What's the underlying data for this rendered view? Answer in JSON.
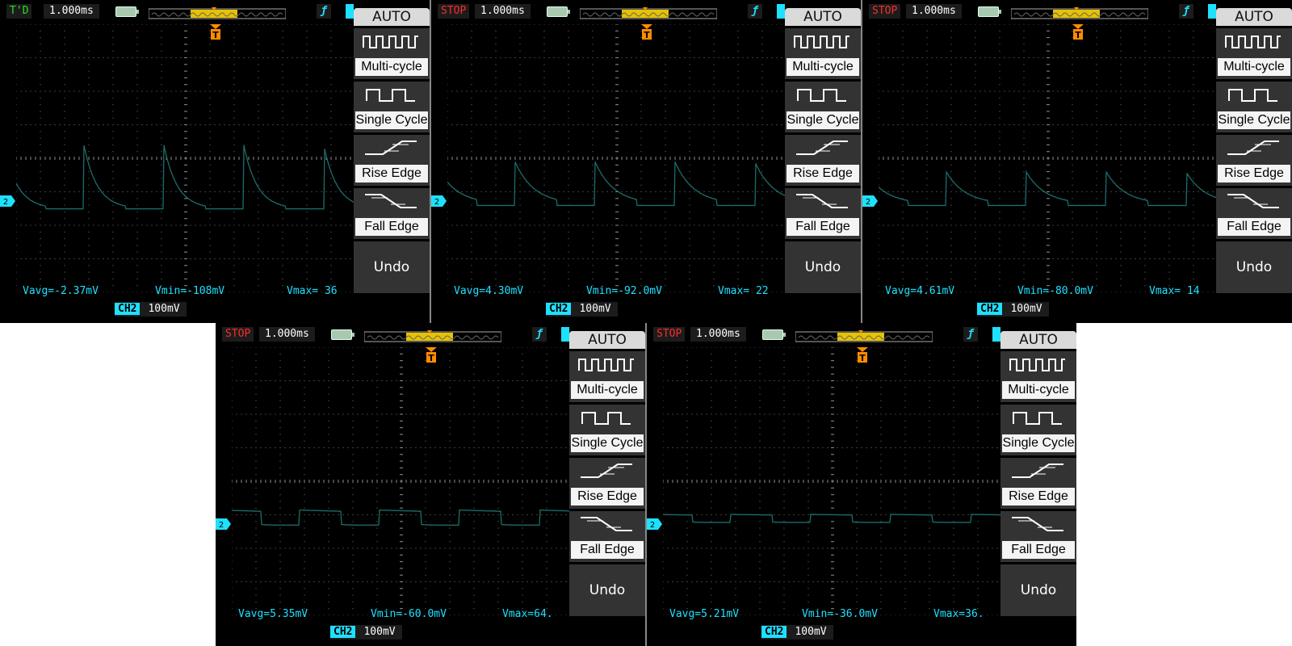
{
  "menu": {
    "title": "AUTO",
    "items": [
      "Multi-cycle",
      "Single Cycle",
      "Rise Edge",
      "Fall Edge"
    ],
    "undo": "Undo"
  },
  "colors": {
    "trace": "#1a6e6e",
    "cyan": "#1ee0ff",
    "stop": "#ff2a2a",
    "run": "#22e022",
    "trig": "#ff8c00"
  },
  "trigger_icon": "f-trigger-icon",
  "ground_marker": "2",
  "screens": [
    {
      "status": "T'D",
      "state": "run",
      "timebase": "1.000ms",
      "channel": "CH2",
      "volts_div": "100mV",
      "vavg": "Vavg=-2.37mV",
      "vmin": "Vmin=-108mV",
      "vmax": "Vmax= 36",
      "signal": {
        "kind": "spike",
        "high": 150,
        "low": -40,
        "base": 0,
        "period": 3.3,
        "phase": 2.8
      }
    },
    {
      "status": "STOP",
      "state": "stop",
      "timebase": "1.000ms",
      "channel": "CH2",
      "volts_div": "100mV",
      "vavg": "Vavg=4.30mV",
      "vmin": "Vmin=-92.0mV",
      "vmax": "Vmax= 22",
      "signal": {
        "kind": "decay",
        "high": 90,
        "low": -30,
        "base": 0,
        "period": 3.3,
        "phase": 2.8
      }
    },
    {
      "status": "STOP",
      "state": "stop",
      "timebase": "1.000ms",
      "channel": "CH2",
      "volts_div": "100mV",
      "vavg": "Vavg=4.61mV",
      "vmin": "Vmin=-80.0mV",
      "vmax": "Vmax= 14",
      "signal": {
        "kind": "decay",
        "high": 60,
        "low": -30,
        "base": 0,
        "period": 3.3,
        "phase": 2.8
      }
    },
    {
      "status": "STOP",
      "state": "stop",
      "timebase": "1.000ms",
      "channel": "CH2",
      "volts_div": "100mV",
      "vavg": "Vavg=5.35mV",
      "vmin": "Vmin=-60.0mV",
      "vmax": "Vmax=64.",
      "signal": {
        "kind": "square",
        "high": 25,
        "low": -20,
        "base": 0,
        "period": 3.3,
        "phase": 2.8
      }
    },
    {
      "status": "STOP",
      "state": "stop",
      "timebase": "1.000ms",
      "channel": "CH2",
      "volts_div": "100mV",
      "vavg": "Vavg=5.21mV",
      "vmin": "Vmin=-36.0mV",
      "vmax": "Vmax=36.",
      "signal": {
        "kind": "square",
        "high": 12,
        "low": -12,
        "base": 0,
        "period": 3.3,
        "phase": 2.8
      }
    }
  ]
}
